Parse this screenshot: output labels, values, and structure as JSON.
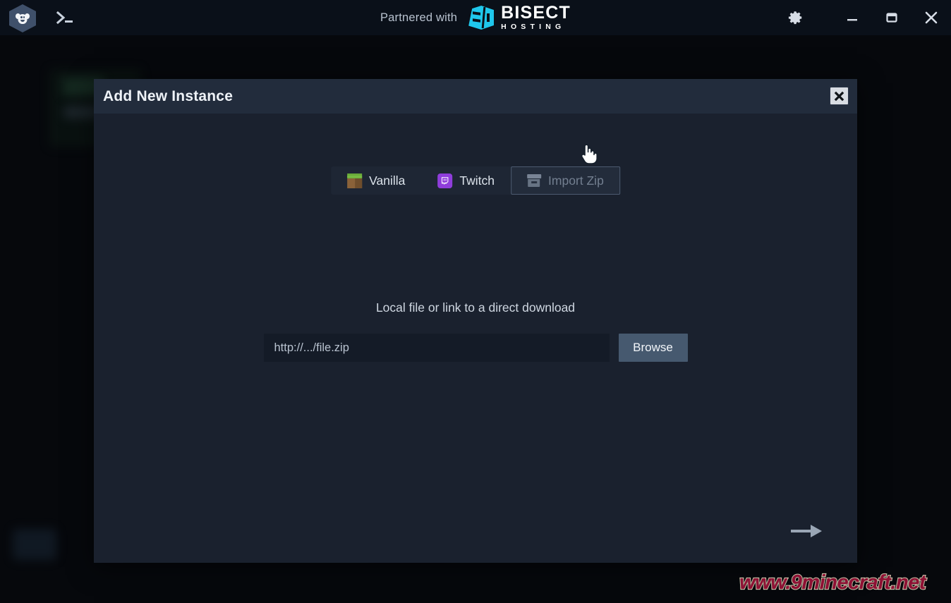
{
  "titlebar": {
    "app_logo_icon": "ape-hexagon-logo",
    "console_icon": "terminal-prompt-icon",
    "partner_prefix": "Partnered with",
    "partner_brand_main": "BISECT",
    "partner_brand_sub": "HOSTING",
    "settings_icon": "gear-icon",
    "minimize_icon": "minimize-icon",
    "maximize_icon": "maximize-icon",
    "close_icon": "close-icon"
  },
  "dialog": {
    "title": "Add New Instance",
    "close_icon": "close-x-icon",
    "tabs": [
      {
        "label": "Vanilla",
        "icon": "minecraft-grass-block-icon",
        "active": false
      },
      {
        "label": "Twitch",
        "icon": "twitch-icon",
        "active": false
      },
      {
        "label": "Import Zip",
        "icon": "archive-box-icon",
        "active": true
      }
    ],
    "form": {
      "label": "Local file or link to a direct download",
      "url_placeholder": "http://.../file.zip",
      "url_value": "",
      "browse_label": "Browse"
    },
    "next_icon": "arrow-right-icon"
  },
  "cursor": {
    "icon": "pointing-hand-cursor"
  },
  "watermark": {
    "text": "www.9minecraft.net"
  },
  "colors": {
    "titlebar_bg": "#0a1019",
    "backdrop": "#06080c",
    "dialog_body": "#1a212e",
    "dialog_header": "#222c3c",
    "accent_button": "#46596f",
    "brand_cyan": "#1fc7ec",
    "twitch_purple": "#8f3ddb",
    "watermark_fill": "#8f1034",
    "watermark_stroke": "#f2e3c8"
  }
}
